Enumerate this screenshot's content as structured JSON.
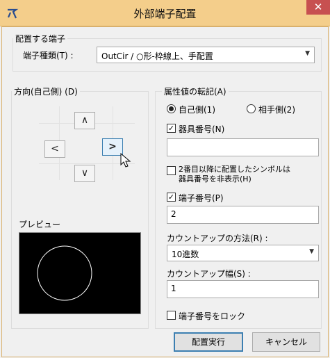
{
  "window": {
    "title": "外部端子配置",
    "close_glyph": "✕",
    "logo_icon": "app-logo-icon"
  },
  "placement_group": {
    "title": "配置する端子",
    "terminal_type_label": "端子種類(T) :",
    "terminal_type_value": "OutCir / ○形-枠線上、手配置"
  },
  "direction_group": {
    "title": "方向(自己側) (D)",
    "up": "∧",
    "down": "∨",
    "left": "<",
    "right": ">"
  },
  "preview": {
    "label": "プレビュー"
  },
  "attribute_group": {
    "title": "属性値の転記(A)",
    "radio_self": "自己側(1)",
    "radio_other": "相手側(2)",
    "device_number_label": "器具番号(N)",
    "device_number_value": "",
    "hide_device_number_label_1": "2番目以降に配置したシンボルは",
    "hide_device_number_label_2": "器具番号を非表示(H)",
    "terminal_number_label": "端子番号(P)",
    "terminal_number_value": "2",
    "countup_method_label": "カウントアップの方法(R) :",
    "countup_method_value": "10進数",
    "countup_step_label": "カウントアップ幅(S) :",
    "countup_step_value": "1",
    "lock_label": "端子番号をロック"
  },
  "buttons": {
    "execute": "配置実行",
    "cancel": "キャンセル"
  },
  "state": {
    "radio_self_selected": true,
    "device_number_checked": true,
    "hide_device_number_checked": false,
    "terminal_number_checked": true,
    "lock_checked": false
  },
  "colors": {
    "title_bar": "#f4ce8b",
    "close_button": "#c75050",
    "accent": "#3c7fb1"
  }
}
